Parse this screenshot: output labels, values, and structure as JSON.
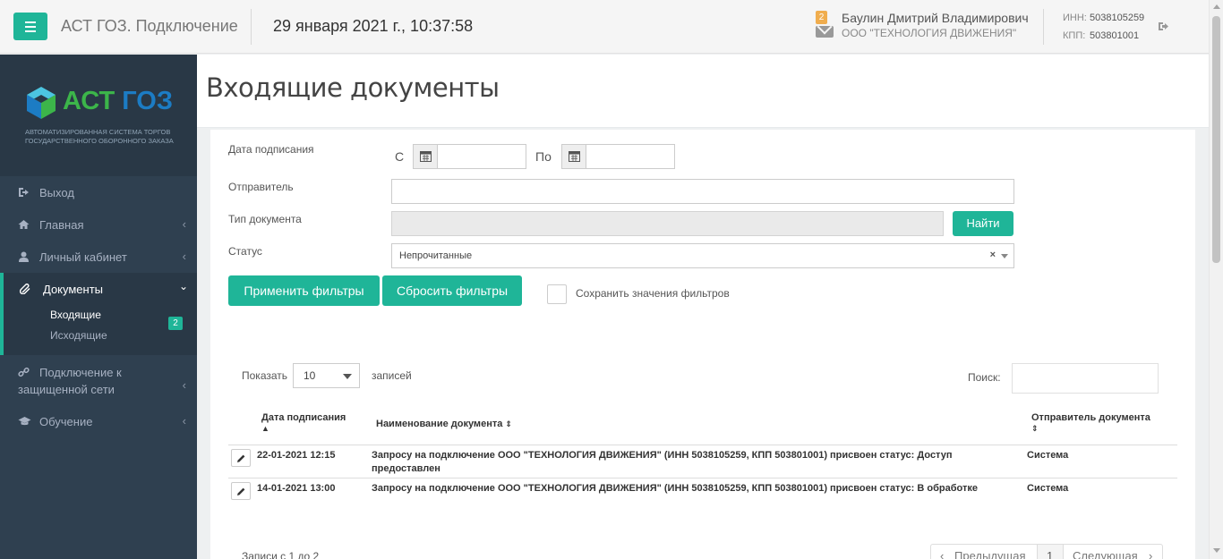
{
  "topbar": {
    "app_title": "АСТ ГОЗ. Подключение",
    "datetime": "29 января 2021 г., 10:37:58",
    "notifications_count": "2",
    "user_name": "Баулин Дмитрий Владимирович",
    "user_org": "ООО \"ТЕХНОЛОГИЯ ДВИЖЕНИЯ\"",
    "inn_label": "ИНН:",
    "inn_value": "5038105259",
    "kpp_label": "КПП:",
    "kpp_value": "503801001"
  },
  "sidebar": {
    "logo_part1": "АСТ",
    "logo_part2": "ГОЗ",
    "logo_subtitle": "Автоматизированная система торгов государственного оборонного заказа",
    "items": [
      {
        "label": "Выход",
        "icon": "sign-out-icon"
      },
      {
        "label": "Главная",
        "icon": "home-icon"
      },
      {
        "label": "Личный кабинет",
        "icon": "user-icon"
      },
      {
        "label": "Документы",
        "icon": "paperclip-icon"
      },
      {
        "label_line1": "Подключение к",
        "label_line2": "защищенной сети",
        "icon": "link-icon"
      },
      {
        "label": "Обучение",
        "icon": "graduation-cap-icon"
      }
    ],
    "sub_items": [
      {
        "label": "Входящие",
        "badge": "2"
      },
      {
        "label": "Исходящие"
      }
    ]
  },
  "page": {
    "title": "Входящие документы"
  },
  "filters": {
    "sign_date_label": "Дата подписания",
    "from_label": "С",
    "to_label": "По",
    "sender_label": "Отправитель",
    "doc_type_label": "Тип документа",
    "status_label": "Статус",
    "status_value": "Непрочитанные",
    "find_button": "Найти",
    "apply_button": "Применить фильтры",
    "reset_button": "Сбросить фильтры",
    "save_label": "Сохранить значения фильтров"
  },
  "table_controls": {
    "show_label": "Показать",
    "page_length": "10",
    "records_label": "записей",
    "search_label": "Поиск:"
  },
  "table": {
    "columns": [
      "Дата подписания",
      "Наименование документа",
      "Отправитель документа"
    ],
    "rows": [
      {
        "date": "22-01-2021 12:15",
        "name": "Запросу на подключение ООО \"ТЕХНОЛОГИЯ ДВИЖЕНИЯ\" (ИНН 5038105259, КПП 503801001) присвоен статус: Доступ предоставлен",
        "sender": "Система"
      },
      {
        "date": "14-01-2021 13:00",
        "name": "Запросу на подключение ООО \"ТЕХНОЛОГИЯ ДВИЖЕНИЯ\" (ИНН 5038105259, КПП 503801001) присвоен статус: В обработке",
        "sender": "Система"
      }
    ]
  },
  "footer": {
    "info": "Записи с 1 до 2",
    "prev": "Предыдущая",
    "page": "1",
    "next": "Следующая"
  },
  "colors": {
    "accent": "#1fb598",
    "sidebar": "#2f4050",
    "notify_badge": "#f0ad4e"
  }
}
